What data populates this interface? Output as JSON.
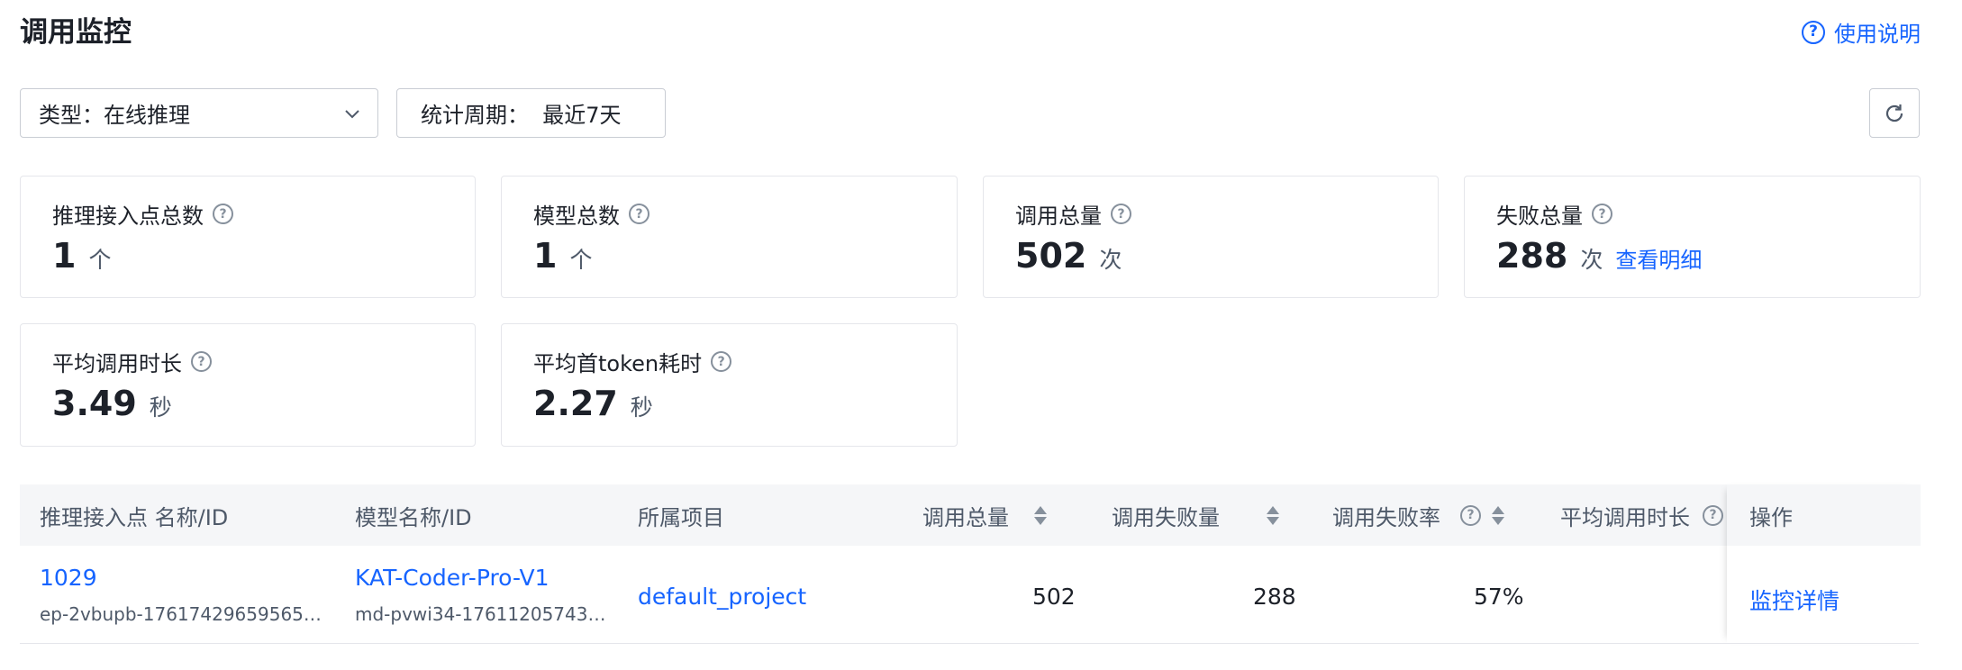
{
  "page": {
    "title": "调用监控",
    "help": "使用说明"
  },
  "filters": {
    "type_label": "类型：在线推理",
    "period_label": "统计周期：  最近7天"
  },
  "stats": [
    {
      "label": "推理接入点总数",
      "value": "1",
      "unit": "个"
    },
    {
      "label": "模型总数",
      "value": "1",
      "unit": "个"
    },
    {
      "label": "调用总量",
      "value": "502",
      "unit": "次"
    },
    {
      "label": "失败总量",
      "value": "288",
      "unit": "次",
      "link": "查看明细"
    },
    {
      "label": "平均调用时长",
      "value": "3.49",
      "unit": "秒"
    },
    {
      "label": "平均首token耗时",
      "value": "2.27",
      "unit": "秒"
    }
  ],
  "table": {
    "headers": {
      "endpoint": "推理接入点 名称/ID",
      "model": "模型名称/ID",
      "project": "所属项目",
      "total": "调用总量",
      "fail": "调用失败量",
      "fail_rate": "调用失败率",
      "avg": "平均调用时长",
      "action": "操作"
    },
    "rows": [
      {
        "endpoint_name": "1029",
        "endpoint_id": "ep-2vbupb-17617429659565…",
        "model_name": "KAT-Coder-Pro-V1",
        "model_id": "md-pvwi34-17611205743…",
        "project": "default_project",
        "total": "502",
        "fail": "288",
        "fail_rate": "57%",
        "action": "监控详情"
      }
    ]
  },
  "colors": {
    "accent": "#1664ff",
    "text": "#1d2129",
    "muted": "#86909c",
    "header_bg": "#f5f6f8"
  }
}
